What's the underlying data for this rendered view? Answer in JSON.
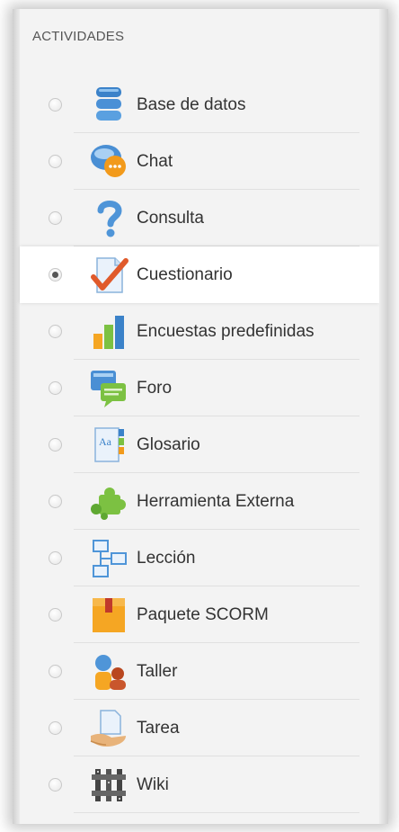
{
  "section": {
    "title": "ACTIVIDADES"
  },
  "activities": [
    {
      "label": "Base de datos",
      "icon": "database-icon",
      "selected": false
    },
    {
      "label": "Chat",
      "icon": "chat-icon",
      "selected": false
    },
    {
      "label": "Consulta",
      "icon": "question-icon",
      "selected": false
    },
    {
      "label": "Cuestionario",
      "icon": "quiz-icon",
      "selected": true
    },
    {
      "label": "Encuestas predefinidas",
      "icon": "survey-icon",
      "selected": false
    },
    {
      "label": "Foro",
      "icon": "forum-icon",
      "selected": false
    },
    {
      "label": "Glosario",
      "icon": "glossary-icon",
      "selected": false
    },
    {
      "label": "Herramienta Externa",
      "icon": "external-tool-icon",
      "selected": false
    },
    {
      "label": "Lección",
      "icon": "lesson-icon",
      "selected": false
    },
    {
      "label": "Paquete SCORM",
      "icon": "scorm-package-icon",
      "selected": false
    },
    {
      "label": "Taller",
      "icon": "workshop-icon",
      "selected": false
    },
    {
      "label": "Tarea",
      "icon": "assignment-icon",
      "selected": false
    },
    {
      "label": "Wiki",
      "icon": "wiki-icon",
      "selected": false
    }
  ],
  "colors": {
    "panel_bg": "#f3f3f3",
    "selected_bg": "#ffffff",
    "text": "#333333"
  }
}
